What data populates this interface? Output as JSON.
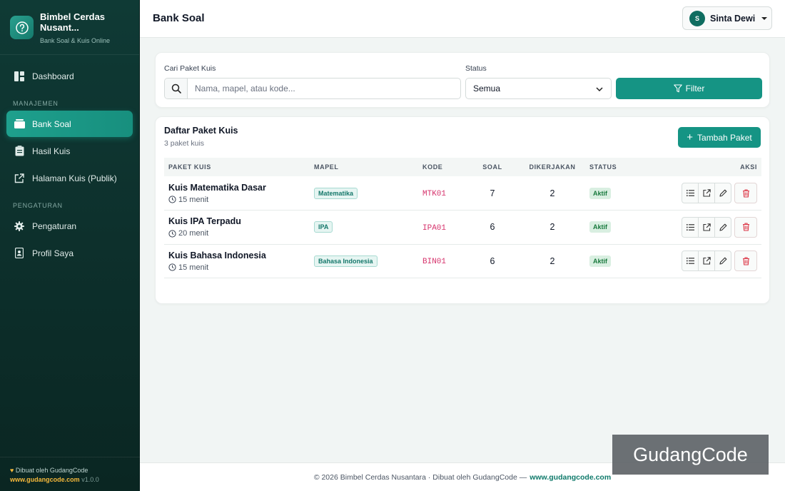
{
  "brand": {
    "title": "Bimbel Cerdas Nusant...",
    "subtitle": "Bank Soal & Kuis Online"
  },
  "sidebar": {
    "items_top": [
      {
        "label": "Dashboard",
        "icon": "dashboard-icon"
      }
    ],
    "section_manajemen": "MANAJEMEN",
    "items_manajemen": [
      {
        "label": "Bank Soal",
        "icon": "bank-soal-icon",
        "active": true
      },
      {
        "label": "Hasil Kuis",
        "icon": "clipboard-icon"
      },
      {
        "label": "Halaman Kuis (Publik)",
        "icon": "external-link-icon"
      }
    ],
    "section_pengaturan": "PENGATURAN",
    "items_pengaturan": [
      {
        "label": "Pengaturan",
        "icon": "gear-icon"
      },
      {
        "label": "Profil Saya",
        "icon": "profile-icon"
      }
    ],
    "footer": {
      "made_by": "Dibuat oleh GudangCode",
      "link": "www.gudangcode.com",
      "version": "v1.0.0"
    }
  },
  "header": {
    "title": "Bank Soal",
    "user": {
      "initial": "S",
      "name": "Sinta Dewi"
    }
  },
  "filter": {
    "search_label": "Cari Paket Kuis",
    "search_placeholder": "Nama, mapel, atau kode...",
    "status_label": "Status",
    "status_value": "Semua",
    "button": "Filter"
  },
  "list": {
    "title": "Daftar Paket Kuis",
    "count_text": "3 paket kuis",
    "add_button": "Tambah Paket",
    "columns": [
      "PAKET KUIS",
      "MAPEL",
      "KODE",
      "SOAL",
      "DIKERJAKAN",
      "STATUS",
      "AKSI"
    ],
    "rows": [
      {
        "name": "Kuis Matematika Dasar",
        "duration": "15 menit",
        "mapel": "Matematika",
        "kode": "MTK01",
        "soal": "7",
        "dikerjakan": "2",
        "status": "Aktif"
      },
      {
        "name": "Kuis IPA Terpadu",
        "duration": "20 menit",
        "mapel": "IPA",
        "kode": "IPA01",
        "soal": "6",
        "dikerjakan": "2",
        "status": "Aktif"
      },
      {
        "name": "Kuis Bahasa Indonesia",
        "duration": "15 menit",
        "mapel": "Bahasa Indonesia",
        "kode": "BIN01",
        "soal": "6",
        "dikerjakan": "2",
        "status": "Aktif"
      }
    ]
  },
  "footer": {
    "text": "© 2026 Bimbel Cerdas Nusantara · Dibuat oleh GudangCode —",
    "link": "www.gudangcode.com"
  },
  "watermark": "GudangCode",
  "colors": {
    "accent": "#159484",
    "sidebar_bg": "#0f3a35",
    "code_text": "#d6336c",
    "status_green": "#1a7a3e"
  }
}
